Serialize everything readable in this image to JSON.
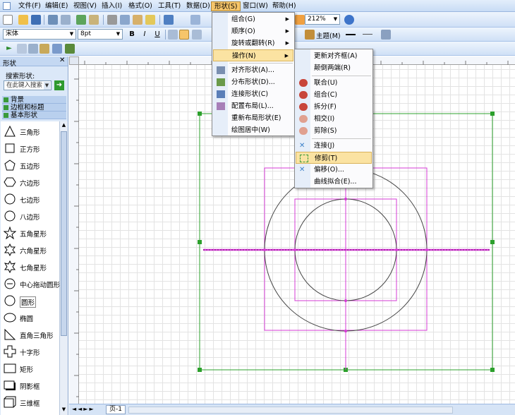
{
  "menubar": {
    "items": [
      "文件(F)",
      "编辑(E)",
      "视图(V)",
      "插入(I)",
      "格式(O)",
      "工具(T)",
      "数据(D)",
      "形状(S)",
      "窗口(W)",
      "帮助(H)"
    ],
    "active_index": 7
  },
  "toolbar": {
    "font_name": "宋体",
    "font_size": "8pt",
    "zoom": "212%",
    "theme_label": "主题(M)"
  },
  "panel": {
    "title": "形状",
    "search_label": "搜索形状:",
    "search_placeholder": "在此键入搜索",
    "stencils": [
      "背景",
      "边框和标题",
      "基本形状"
    ],
    "shapes": [
      "三角形",
      "正方形",
      "五边形",
      "六边形",
      "七边形",
      "八边形",
      "五角星形",
      "六角星形",
      "七角星形",
      "中心拖动圆形",
      "圆形",
      "椭圆",
      "直角三角形",
      "十字形",
      "矩形",
      "阴影框",
      "三维框"
    ]
  },
  "shape_menu": {
    "items": [
      "组合(G)",
      "顺序(O)",
      "旋转或翻转(R)",
      "操作(N)",
      "对齐形状(A)...",
      "分布形状(D)...",
      "连接形状(C)",
      "配置布局(L)...",
      "重新布局形状(E)",
      "绘图居中(W)"
    ],
    "highlighted": "操作(N)"
  },
  "operations_menu": {
    "items": [
      "更新对齐框(A)",
      "颠倒两端(R)",
      "联合(U)",
      "组合(C)",
      "拆分(F)",
      "相交(I)",
      "剪除(S)",
      "连接(J)",
      "修剪(T)",
      "偏移(O)...",
      "曲线拟合(E)..."
    ],
    "highlighted": "修剪(T)"
  },
  "status": {
    "page_tab": "页-1"
  },
  "colors": {
    "accent_highlight": "#f6c56a",
    "selection_green": "#2ca02c",
    "guide_magenta": "#d63bd6"
  }
}
